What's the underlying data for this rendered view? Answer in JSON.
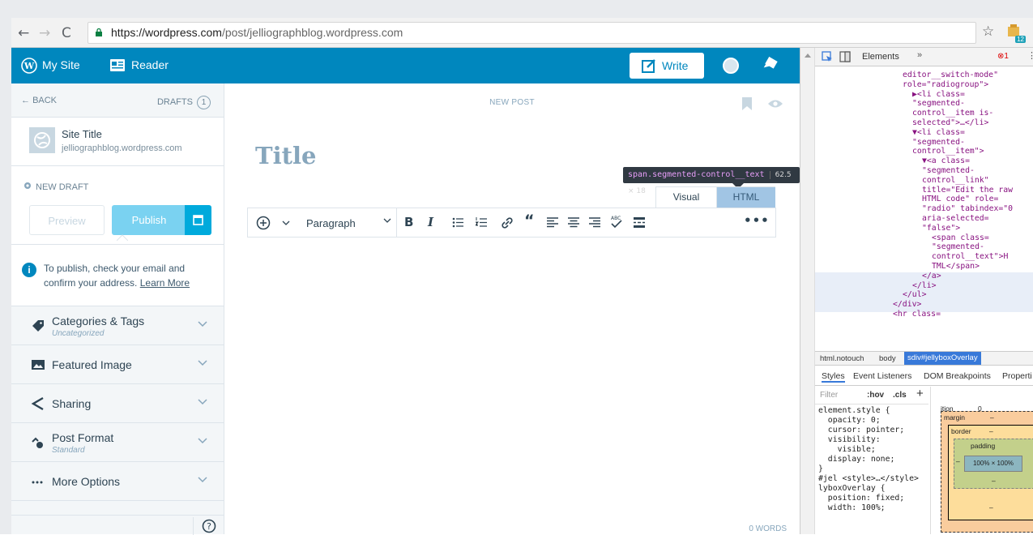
{
  "browser": {
    "url_host": "https://wordpress.com",
    "url_path": "/post/jelliographblog.wordpress.com",
    "extension_badge": "12"
  },
  "masterbar": {
    "my_site": "My Site",
    "reader": "Reader",
    "write": "Write"
  },
  "sidebar": {
    "back": "BACK",
    "drafts": "DRAFTS",
    "drafts_count": "1",
    "site_title": "Site Title",
    "site_url": "jelliographblog.wordpress.com",
    "new_draft": "NEW DRAFT",
    "preview": "Preview",
    "publish": "Publish",
    "notice_text": "To publish, check your email and confirm your address.",
    "notice_link": "Learn More",
    "sections": [
      {
        "title": "Categories & Tags",
        "subtitle": "Uncategorized"
      },
      {
        "title": "Featured Image",
        "subtitle": ""
      },
      {
        "title": "Sharing",
        "subtitle": ""
      },
      {
        "title": "Post Format",
        "subtitle": "Standard"
      },
      {
        "title": "More Options",
        "subtitle": ""
      }
    ]
  },
  "editor": {
    "new_post": "NEW POST",
    "title_placeholder": "Title",
    "tab_visual": "Visual",
    "tab_html": "HTML",
    "format_select": "Paragraph",
    "word_count": "0 WORDS",
    "tooltip_selector": "span.segmented-control__text",
    "tooltip_size": "62.5 × 18"
  },
  "devtools": {
    "tab_elements": "Elements",
    "error_count": "1",
    "dom_lines": [
      "editor__switch-mode\"",
      "role=\"radiogroup\">",
      "▶<li class=",
      "\"segmented-",
      "control__item is-",
      "selected\">…</li>",
      "▼<li class=",
      "\"segmented-",
      "control__item\">",
      "▼<a class=",
      "\"segmented-",
      "control__link\"",
      "title=\"Edit the raw",
      "HTML code\" role=",
      "\"radio\" tabindex=\"0",
      "aria-selected=",
      "\"false\">",
      "<span class=",
      "\"segmented-",
      "control__text\">H",
      "TML</span>",
      "</a>",
      "</li>",
      "</ul>",
      "</div>",
      "<hr class="
    ],
    "breadcrumbs": [
      "html.notouch",
      "body",
      "sdiv#jellyboxOverlay"
    ],
    "style_tabs": [
      "Styles",
      "Event Listeners",
      "DOM Breakpoints",
      "Properti"
    ],
    "filter_placeholder": "Filter",
    "filter_hov": ":hov",
    "filter_cls": ".cls",
    "css_text": "element.style {\n  opacity: 0;\n  cursor: pointer;\n  visibility:\n    visible;\n  display: none;\n}\n#jel <style>…</style>\nlyboxOverlay {\n  position: fixed;\n  width: 100%;",
    "box_position_label": "ition",
    "box_position_value": "0",
    "box_margin": "margin",
    "box_border": "border",
    "box_padding": "padding",
    "box_content": "100% × 100%",
    "box_dash": "–"
  }
}
